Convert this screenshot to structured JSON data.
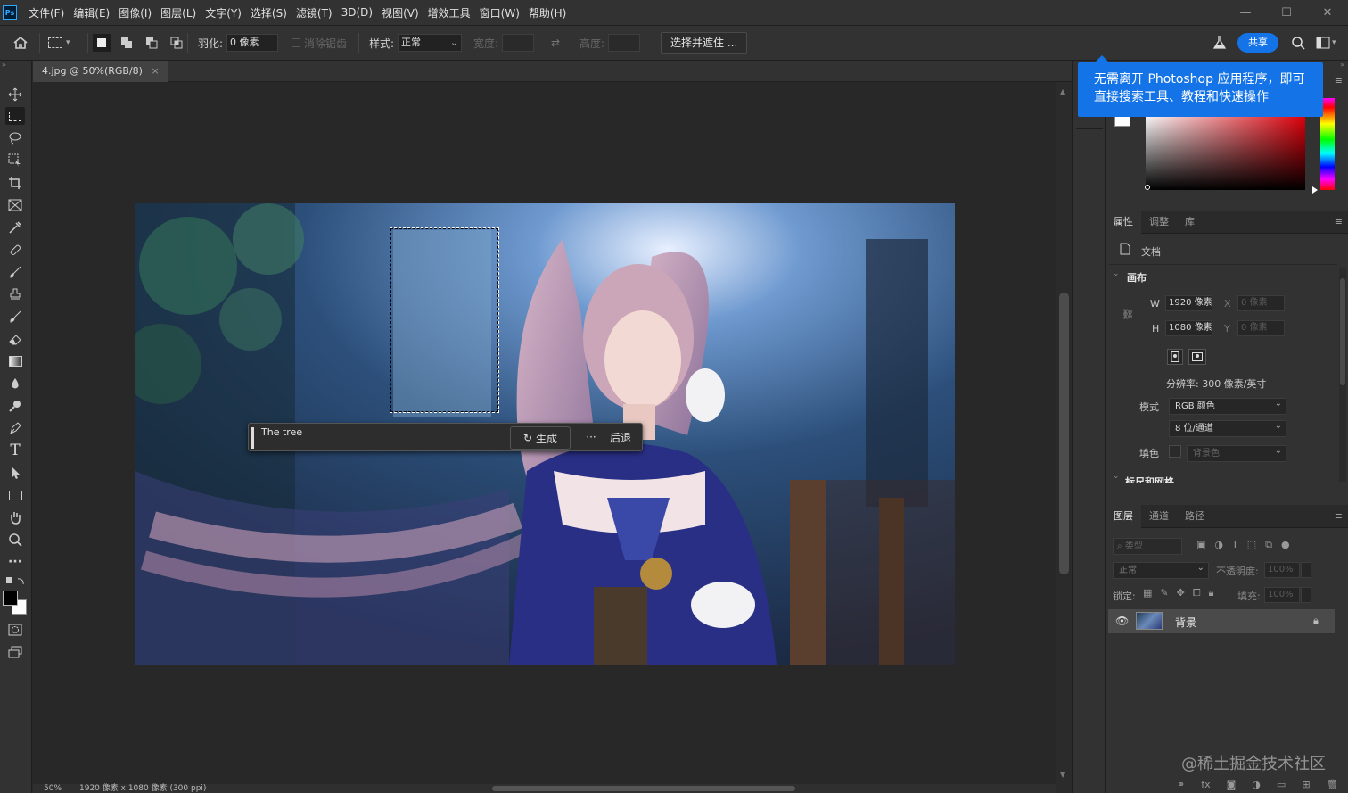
{
  "app": {
    "logo": "Ps"
  },
  "menu": [
    "文件(F)",
    "编辑(E)",
    "图像(I)",
    "图层(L)",
    "文字(Y)",
    "选择(S)",
    "滤镜(T)",
    "3D(D)",
    "视图(V)",
    "增效工具",
    "窗口(W)",
    "帮助(H)"
  ],
  "window_controls": {
    "minimize": "—",
    "maximize": "☐",
    "close": "✕"
  },
  "options": {
    "feather_label": "羽化:",
    "feather_value": "0 像素",
    "antialias_label": "消除锯齿",
    "style_label": "样式:",
    "style_value": "正常",
    "width_label": "宽度:",
    "height_label": "高度:",
    "select_mask_button": "选择并遮住 ...",
    "share_button": "共享"
  },
  "document_tab": {
    "title": "4.jpg @ 50%(RGB/8)",
    "close": "×"
  },
  "contextual_bar": {
    "prompt_value": "The tree",
    "generate_label": "生成",
    "more_label": "···",
    "undo_label": "后退"
  },
  "tooltip": {
    "line1": "无需离开 Photoshop 应用程序，即可",
    "line2": "直接搜索工具、教程和快速操作"
  },
  "properties_panel": {
    "tabs": [
      "属性",
      "调整",
      "库"
    ],
    "document_label": "文档",
    "canvas_section": "画布",
    "w_label": "W",
    "w_value": "1920 像素",
    "h_label": "H",
    "h_value": "1080 像素",
    "x_label": "X",
    "x_value": "0 像素",
    "y_label": "Y",
    "y_value": "0 像素",
    "resolution": "分辨率: 300 像素/英寸",
    "mode_label": "模式",
    "mode_value": "RGB 颜色",
    "depth_value": "8 位/通道",
    "fill_label": "填色",
    "fill_value": "背景色",
    "next_section": "标尺和网格"
  },
  "layers_panel": {
    "tabs": [
      "图层",
      "通道",
      "路径"
    ],
    "filter_placeholder": "类型",
    "blend_mode": "正常",
    "opacity_label": "不透明度:",
    "opacity_value": "100%",
    "lock_label": "锁定:",
    "fill_label": "填充:",
    "fill_value": "100%",
    "layer_name": "背景"
  },
  "status": {
    "zoom": "50%",
    "dims": "1920 像素 x 1080 像素 (300 ppi)"
  },
  "watermark": "@稀土掘金技术社区",
  "colors": {
    "accent": "#1473e6",
    "panel": "#323232",
    "canvas": "#282828"
  }
}
